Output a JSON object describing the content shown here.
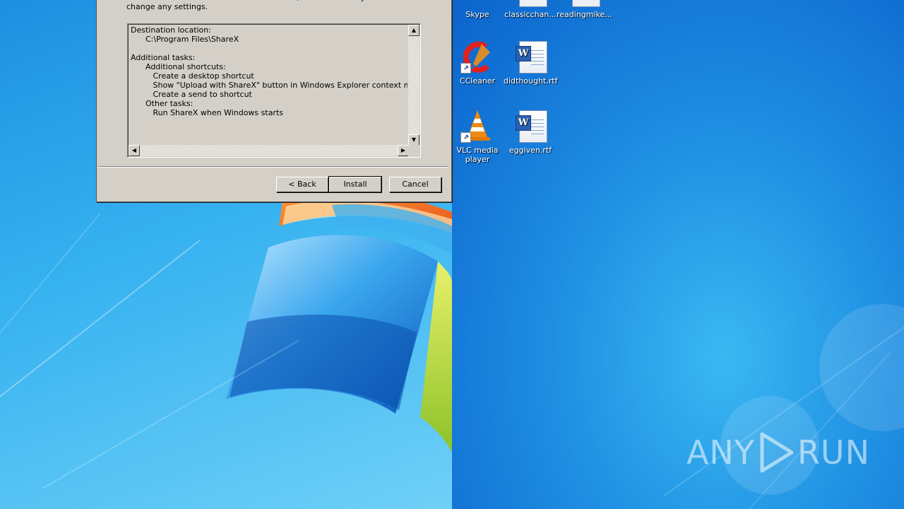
{
  "installer": {
    "intro_text": "Click Install to continue with the installation, or click Back if you want to review or\nchange any settings.",
    "summary": {
      "destination_heading": "Destination location:",
      "destination_path": "C:\\Program Files\\ShareX",
      "additional_tasks_heading": "Additional tasks:",
      "additional_shortcuts_heading": "Additional shortcuts:",
      "shortcut_desktop": "Create a desktop shortcut",
      "shortcut_context_menu": "Show \"Upload with ShareX\" button in Windows Explorer context menu",
      "shortcut_send_to": "Create a send to shortcut",
      "other_tasks_heading": "Other tasks:",
      "other_task_startup": "Run ShareX when Windows starts"
    },
    "buttons": {
      "back": "< Back",
      "install": "Install",
      "cancel": "Cancel"
    }
  },
  "desktop_icons": {
    "skype": "Skype",
    "classicchan": "classicchan...",
    "readingmike": "readingmike...",
    "ccleaner": "CCleaner",
    "didthought": "didthought.rtf",
    "vlc": "VLC media player",
    "eggiven": "eggiven.rtf"
  },
  "watermark": {
    "text_left": "ANY",
    "text_right": "RUN"
  },
  "colors": {
    "dialog_face": "#d4d0c8",
    "desktop_blue": "#1a86e0"
  }
}
